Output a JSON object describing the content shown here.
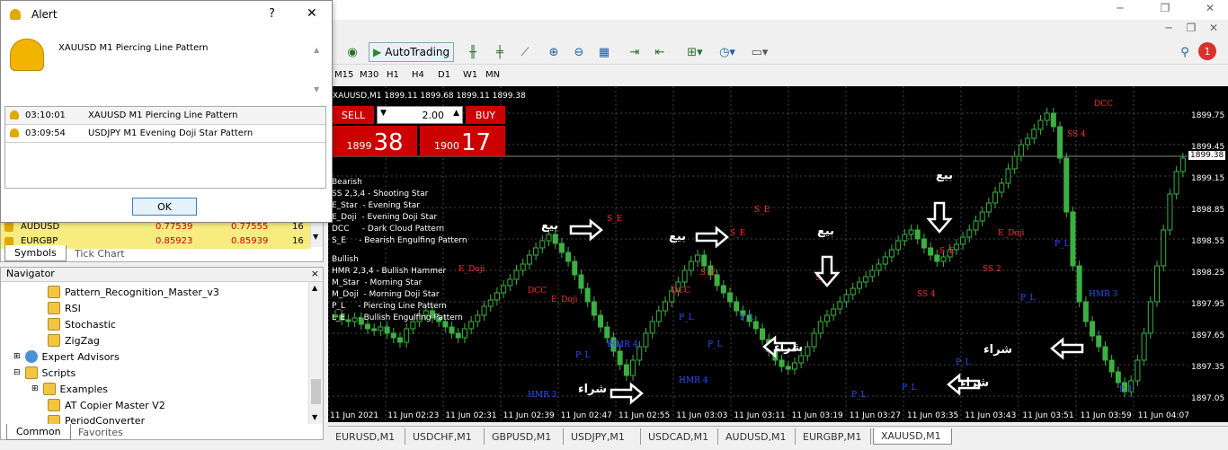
{
  "alert": {
    "title": "Alert",
    "help": "?",
    "close": "✕",
    "message": "XAUUSD M1 Piercing Line Pattern",
    "rows": [
      {
        "time": "03:10:01",
        "text": "XAUUSD M1 Piercing Line Pattern"
      },
      {
        "time": "03:09:54",
        "text": "USDJPY M1 Evening Doji Star Pattern"
      }
    ],
    "ok_label": "OK"
  },
  "market_watch": {
    "rows": [
      {
        "symbol": "AUDUSD",
        "bid": "0.77539",
        "ask": "0.77555",
        "spread": "16"
      },
      {
        "symbol": "EURGBP",
        "bid": "0.85923",
        "ask": "0.85939",
        "spread": "16"
      }
    ],
    "tabs": [
      "Symbols",
      "Tick Chart"
    ]
  },
  "navigator": {
    "title": "Navigator",
    "close": "×",
    "items": [
      {
        "label": "Pattern_Recognition_Master_v3"
      },
      {
        "label": "RSI"
      },
      {
        "label": "Stochastic"
      },
      {
        "label": "ZigZag"
      },
      {
        "label": "Expert Advisors"
      },
      {
        "label": "Scripts"
      },
      {
        "label": "Examples"
      },
      {
        "label": "AT Copier Master V2"
      },
      {
        "label": "PeriodConverter"
      }
    ],
    "tabs": [
      "Common",
      "Favorites"
    ]
  },
  "toolbar": {
    "autotrading": "AutoTrading",
    "timeframes": [
      "M15",
      "M30",
      "H1",
      "H4",
      "D1",
      "W1",
      "MN"
    ],
    "notif_count": "1"
  },
  "chart": {
    "info": "XAUUSD,M1  1899.11 1899.68 1899.11 1899.38",
    "sell_label": "SELL",
    "buy_label": "BUY",
    "lot": "2.00",
    "sell_small": "1899",
    "sell_big": "38",
    "buy_small": "1900",
    "buy_big": "17",
    "legend_bearish": [
      "Bearish",
      "SS 2,3,4 - Shooting Star",
      "E_Star  - Evening Star",
      "E_Doji  - Evening Doji Star",
      "DCC     - Dark Cloud Pattern",
      "S_E     - Bearish Engulfing Pattern"
    ],
    "legend_bullish": [
      "Bullish",
      "HMR 2,3,4 - Bullish Hammer",
      "M_Star  - Morning Star",
      "M_Doji  - Morning Doji Star",
      "P_L     - Piercing Line Pattern",
      "L_E     - Bullish Engulfing Pattern"
    ],
    "current_price": "1899.38",
    "price_labels": [
      "1899.75",
      "1899.45",
      "1899.15",
      "1898.85",
      "1898.55",
      "1898.25",
      "1897.95",
      "1897.65",
      "1897.35",
      "1897.05"
    ],
    "time_labels": [
      "11 Jun 2021",
      "11 Jun 02:23",
      "11 Jun 02:31",
      "11 Jun 02:39",
      "11 Jun 02:47",
      "11 Jun 02:55",
      "11 Jun 03:03",
      "11 Jun 03:11",
      "11 Jun 03:19",
      "11 Jun 03:27",
      "11 Jun 03:35",
      "11 Jun 03:43",
      "11 Jun 03:51",
      "11 Jun 03:59",
      "11 Jun 04:07"
    ],
    "sell_word": "بيع",
    "buy_word": "شراء",
    "bear_labels": [
      "E_Doji",
      "DCC",
      "E_Doji",
      "S_E",
      "DCC",
      "S_E",
      "S_E",
      "S_E",
      "S_E",
      "SS 4",
      "S_E",
      "E_Doji",
      "SS 2",
      "SS 4",
      "DCC"
    ],
    "bull_labels": [
      "HMR 4",
      "HMR 3",
      "P_L",
      "P_L",
      "HMR 4",
      "P_L",
      "P_L",
      "P_L",
      "P_L",
      "P_L",
      "P_L",
      "P_L",
      "P_L",
      "HMR 3",
      "P_L"
    ]
  },
  "tabs": [
    "EURUSD,M1",
    "USDCHF,M1",
    "GBPUSD,M1",
    "USDJPY,M1",
    "USDCAD,M1",
    "AUDUSD,M1",
    "EURGBP,M1",
    "XAUUSD,M1"
  ],
  "colors": {
    "bull": "#3cb043",
    "sell": "#cc0000",
    "bear_label": "#ff3030",
    "bull_label": "#3050ff"
  }
}
